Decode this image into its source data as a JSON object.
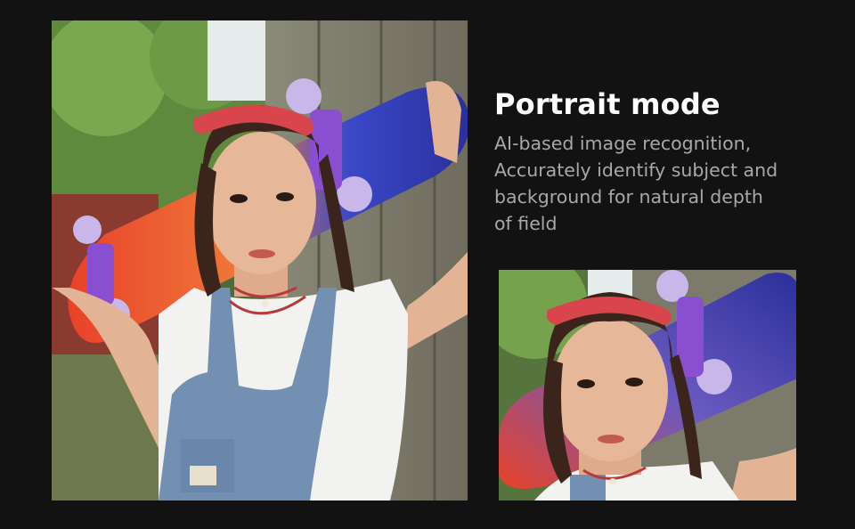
{
  "feature": {
    "title": "Portrait mode",
    "description_lines": [
      "AI-based image recognition,",
      "Accurately identify subject and",
      "background for natural depth",
      "of field"
    ]
  },
  "colors": {
    "background": "#121212",
    "title": "#ffffff",
    "description": "#a8a8a8"
  }
}
